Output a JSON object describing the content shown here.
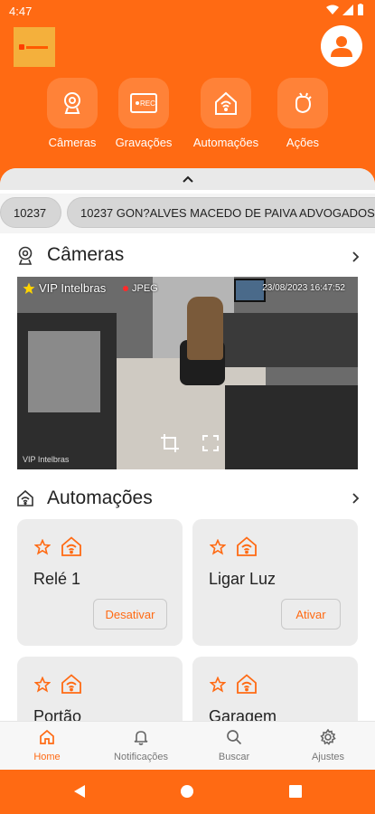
{
  "status_bar": {
    "time": "4:47"
  },
  "header": {
    "actions": [
      {
        "label": "Câmeras",
        "icon": "webcam-icon"
      },
      {
        "label": "Gravações",
        "icon": "rec-icon"
      },
      {
        "label": "Automações",
        "icon": "smart-home-icon"
      },
      {
        "label": "Ações",
        "icon": "hand-tap-icon"
      }
    ]
  },
  "chips": [
    {
      "label": "10237"
    },
    {
      "label": "10237 GON?ALVES MACEDO DE PAIVA ADVOGADOS"
    }
  ],
  "cameras_section": {
    "title": "Câmeras",
    "feed": {
      "name": "VIP Intelbras",
      "format": "JPEG",
      "timestamp": "23/08/2023 16:47:52",
      "watermark": "VIP Intelbras"
    }
  },
  "automations_section": {
    "title": "Automações",
    "cards": [
      {
        "name": "Relé 1",
        "button": "Desativar"
      },
      {
        "name": "Ligar Luz",
        "button": "Ativar"
      },
      {
        "name": "Portão",
        "button": ""
      },
      {
        "name": "Garagem",
        "button": ""
      }
    ]
  },
  "bottom_nav": [
    {
      "label": "Home",
      "active": true
    },
    {
      "label": "Notificações",
      "active": false
    },
    {
      "label": "Buscar",
      "active": false
    },
    {
      "label": "Ajustes",
      "active": false
    }
  ],
  "colors": {
    "accent": "#ff6a13",
    "card": "#ececec",
    "chip": "#d6d6d6"
  }
}
